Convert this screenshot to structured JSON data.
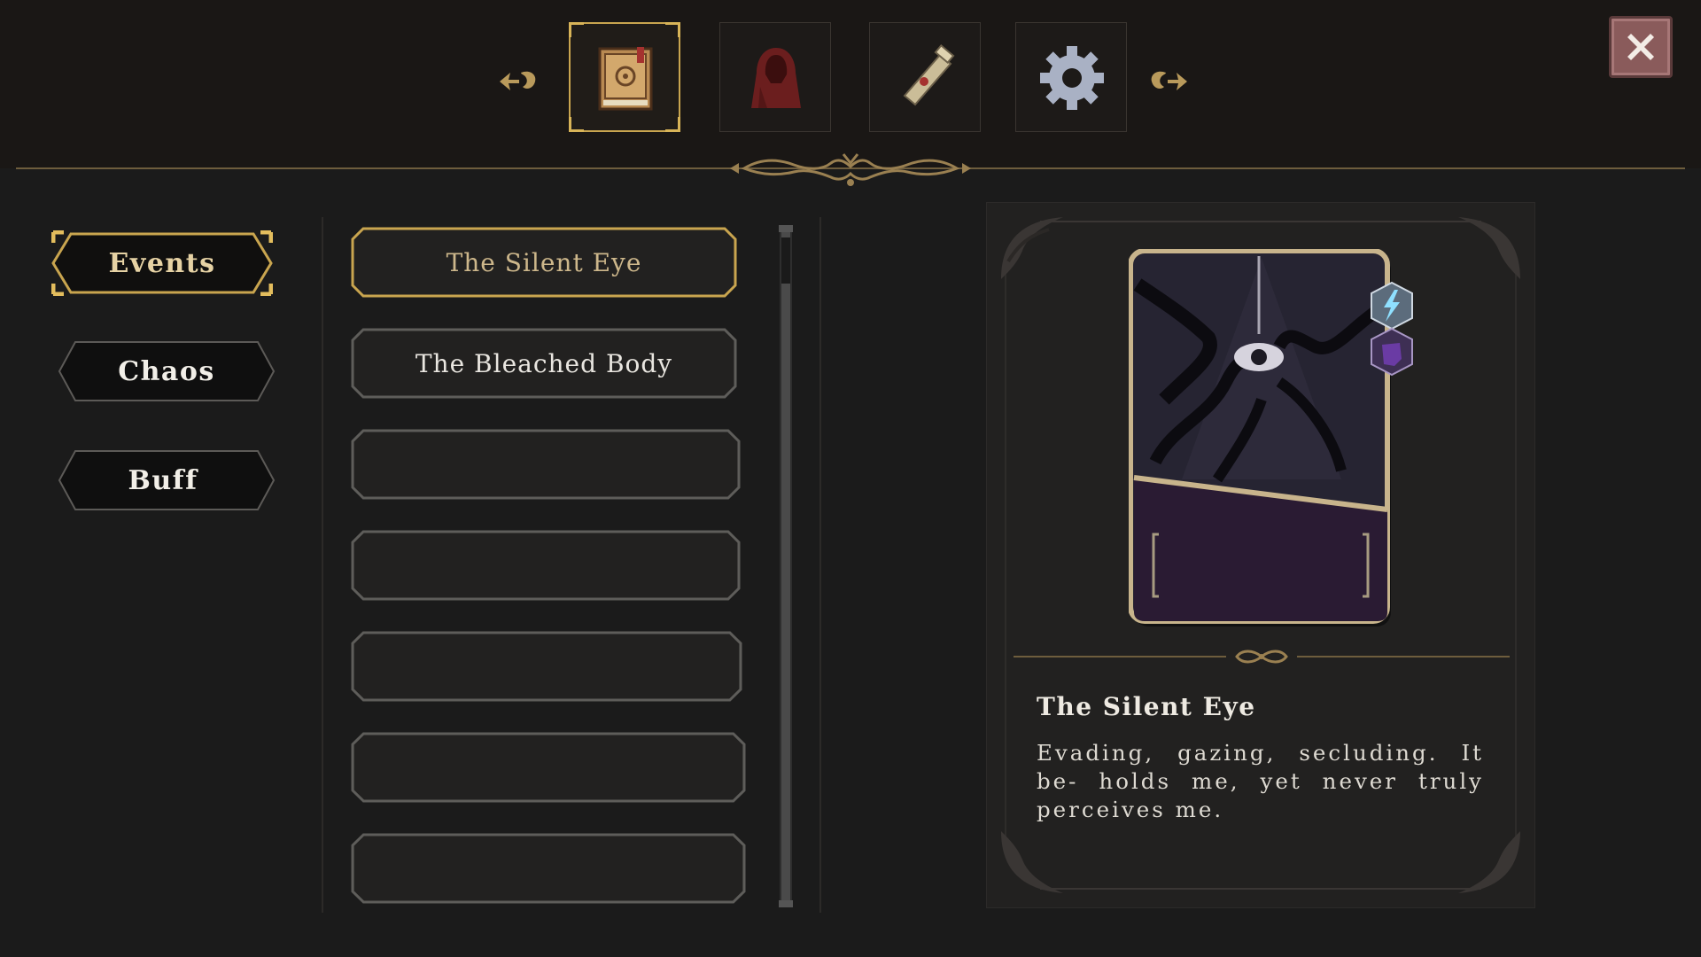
{
  "toolbar": {
    "tabs": [
      {
        "icon": "codex-book-icon",
        "active": true
      },
      {
        "icon": "hooded-cloak-icon",
        "active": false
      },
      {
        "icon": "scroll-icon",
        "active": false
      },
      {
        "icon": "gear-icon",
        "active": false
      }
    ],
    "prev_icon": "arrow-left-icon",
    "next_icon": "arrow-right-icon",
    "close_icon": "close-icon"
  },
  "categories": [
    {
      "label": "Events",
      "active": true
    },
    {
      "label": "Chaos",
      "active": false
    },
    {
      "label": "Buff",
      "active": false
    }
  ],
  "entries": [
    {
      "label": "The Silent Eye",
      "active": true
    },
    {
      "label": "The Bleached Body",
      "active": false
    },
    {
      "label": "",
      "active": false
    },
    {
      "label": "",
      "active": false
    },
    {
      "label": "",
      "active": false
    },
    {
      "label": "",
      "active": false
    },
    {
      "label": "",
      "active": false
    }
  ],
  "detail": {
    "title": "The Silent Eye",
    "description": "Evading, gazing, secluding. It be- holds me, yet never truly perceives me.",
    "badges": [
      "lightning-badge-icon",
      "fist-badge-icon"
    ]
  },
  "colors": {
    "gold": "#c9a54f",
    "background": "#1b1b1b",
    "panel": "#222120",
    "card_purple": "#2a1b33"
  }
}
